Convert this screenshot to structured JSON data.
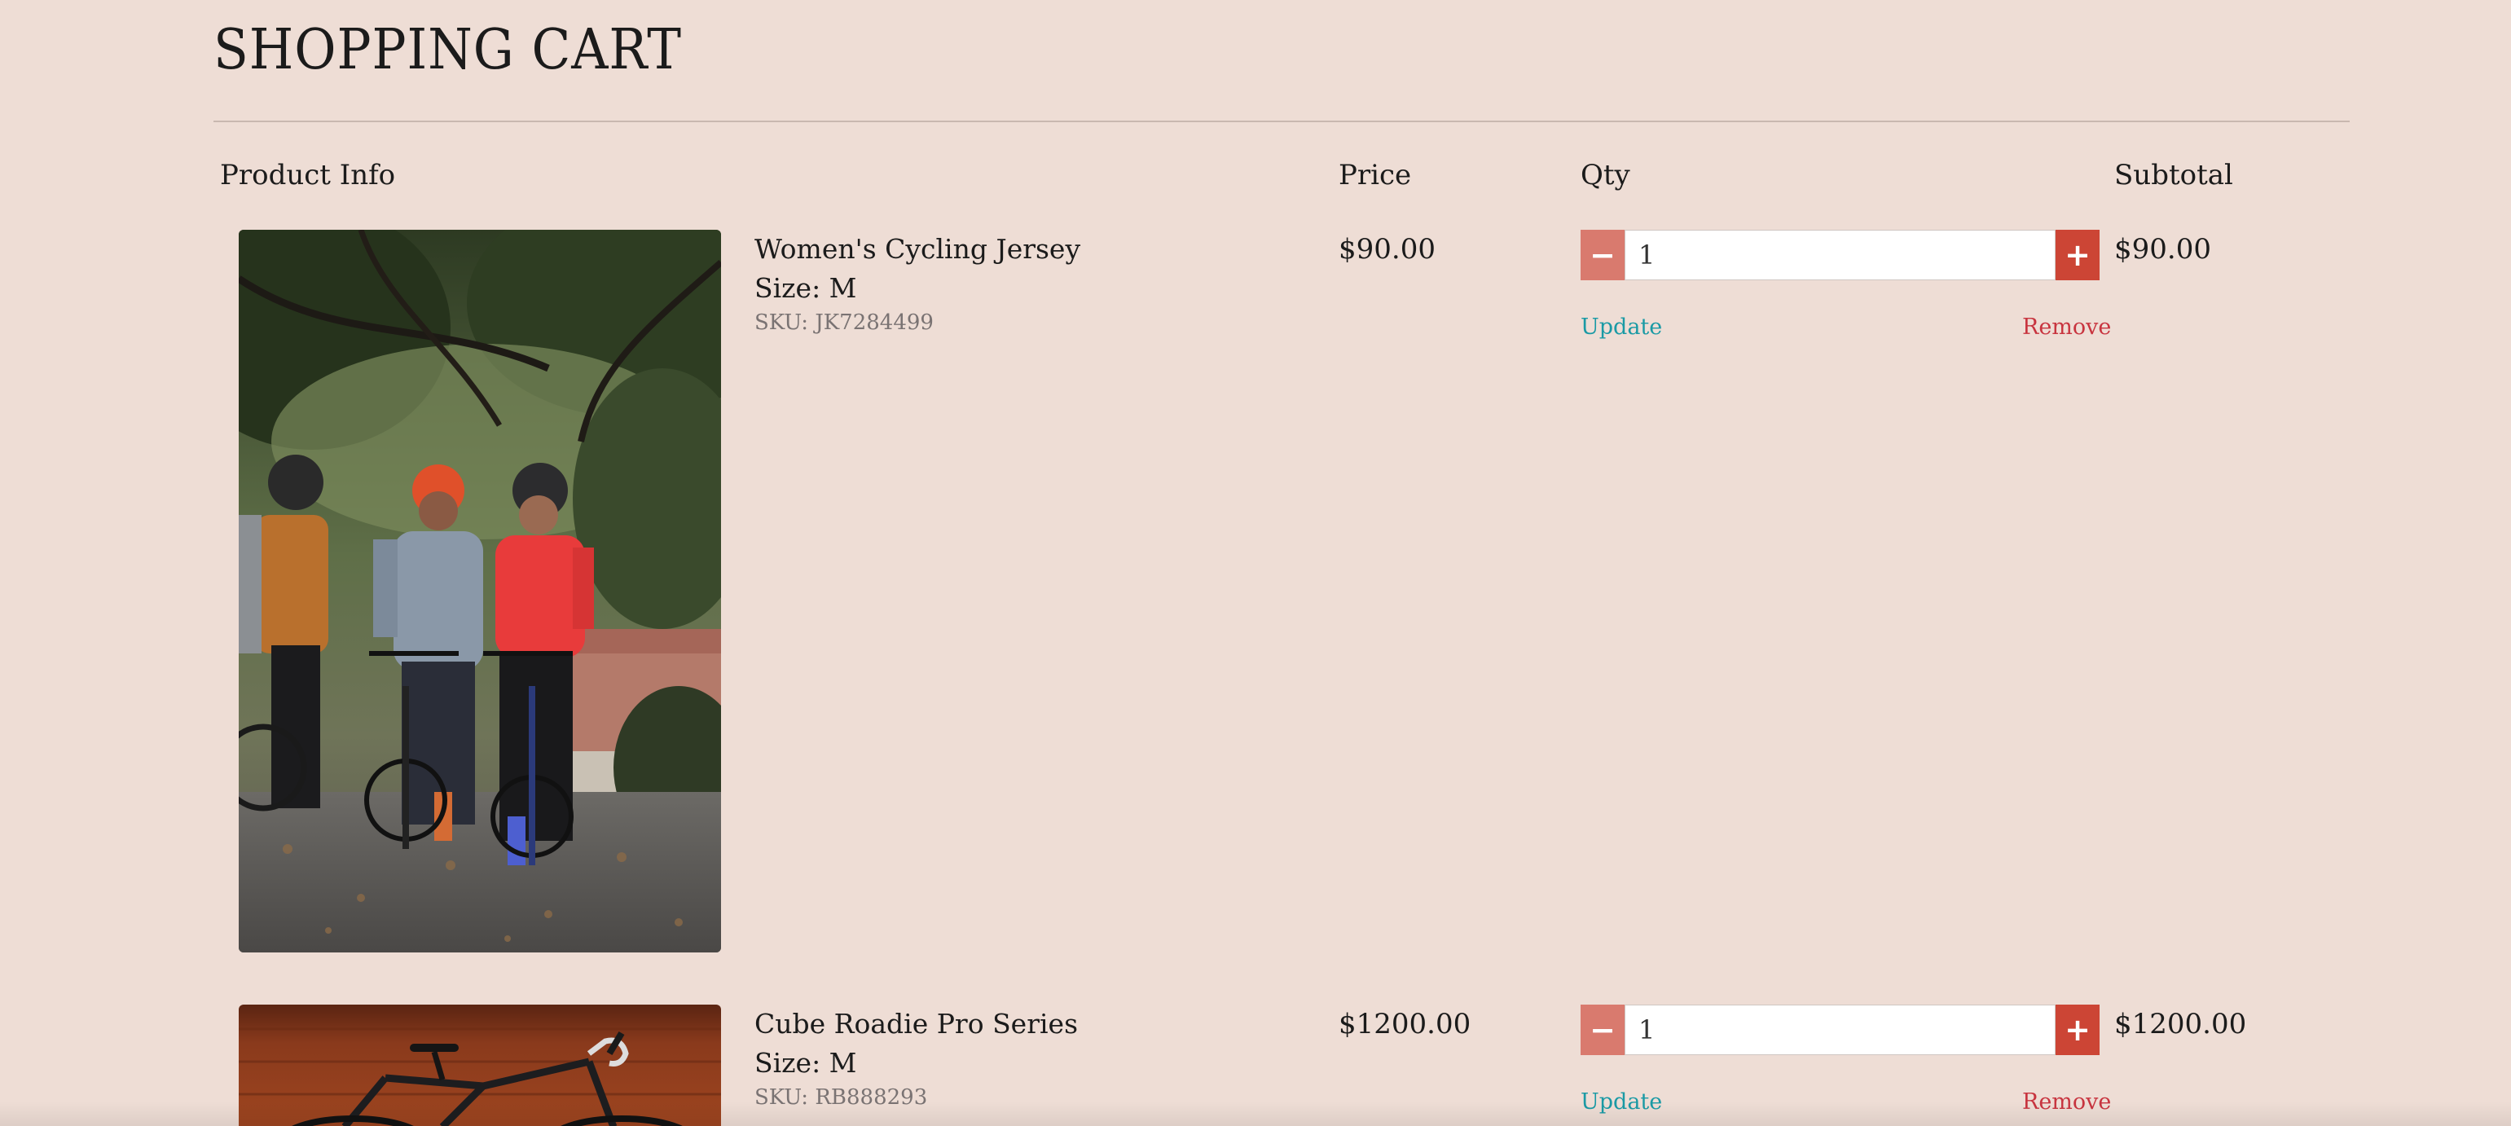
{
  "page": {
    "title": "SHOPPING CART"
  },
  "columns": {
    "product_info": "Product Info",
    "price": "Price",
    "qty": "Qty",
    "subtotal": "Subtotal"
  },
  "items": [
    {
      "name": "Women's Cycling Jersey",
      "size": "Size: M",
      "sku": "SKU: JK7284499",
      "price": "$90.00",
      "qty": "1",
      "subtotal": "$90.00",
      "update_label": "Update",
      "remove_label": "Remove",
      "minus_label": "−",
      "plus_label": "+"
    },
    {
      "name": "Cube Roadie Pro Series",
      "size": "Size: M",
      "sku": "SKU: RB888293",
      "price": "$1200.00",
      "qty": "1",
      "subtotal": "$1200.00",
      "update_label": "Update",
      "remove_label": "Remove",
      "minus_label": "−",
      "plus_label": "+"
    }
  ],
  "colors": {
    "background": "#eeddd5",
    "minus_button": "#d97a6e",
    "plus_button": "#cc4535",
    "update_link": "#1a9aa5",
    "remove_link": "#c8343f"
  },
  "icons": {
    "decrement": "minus-icon",
    "increment": "plus-icon"
  }
}
